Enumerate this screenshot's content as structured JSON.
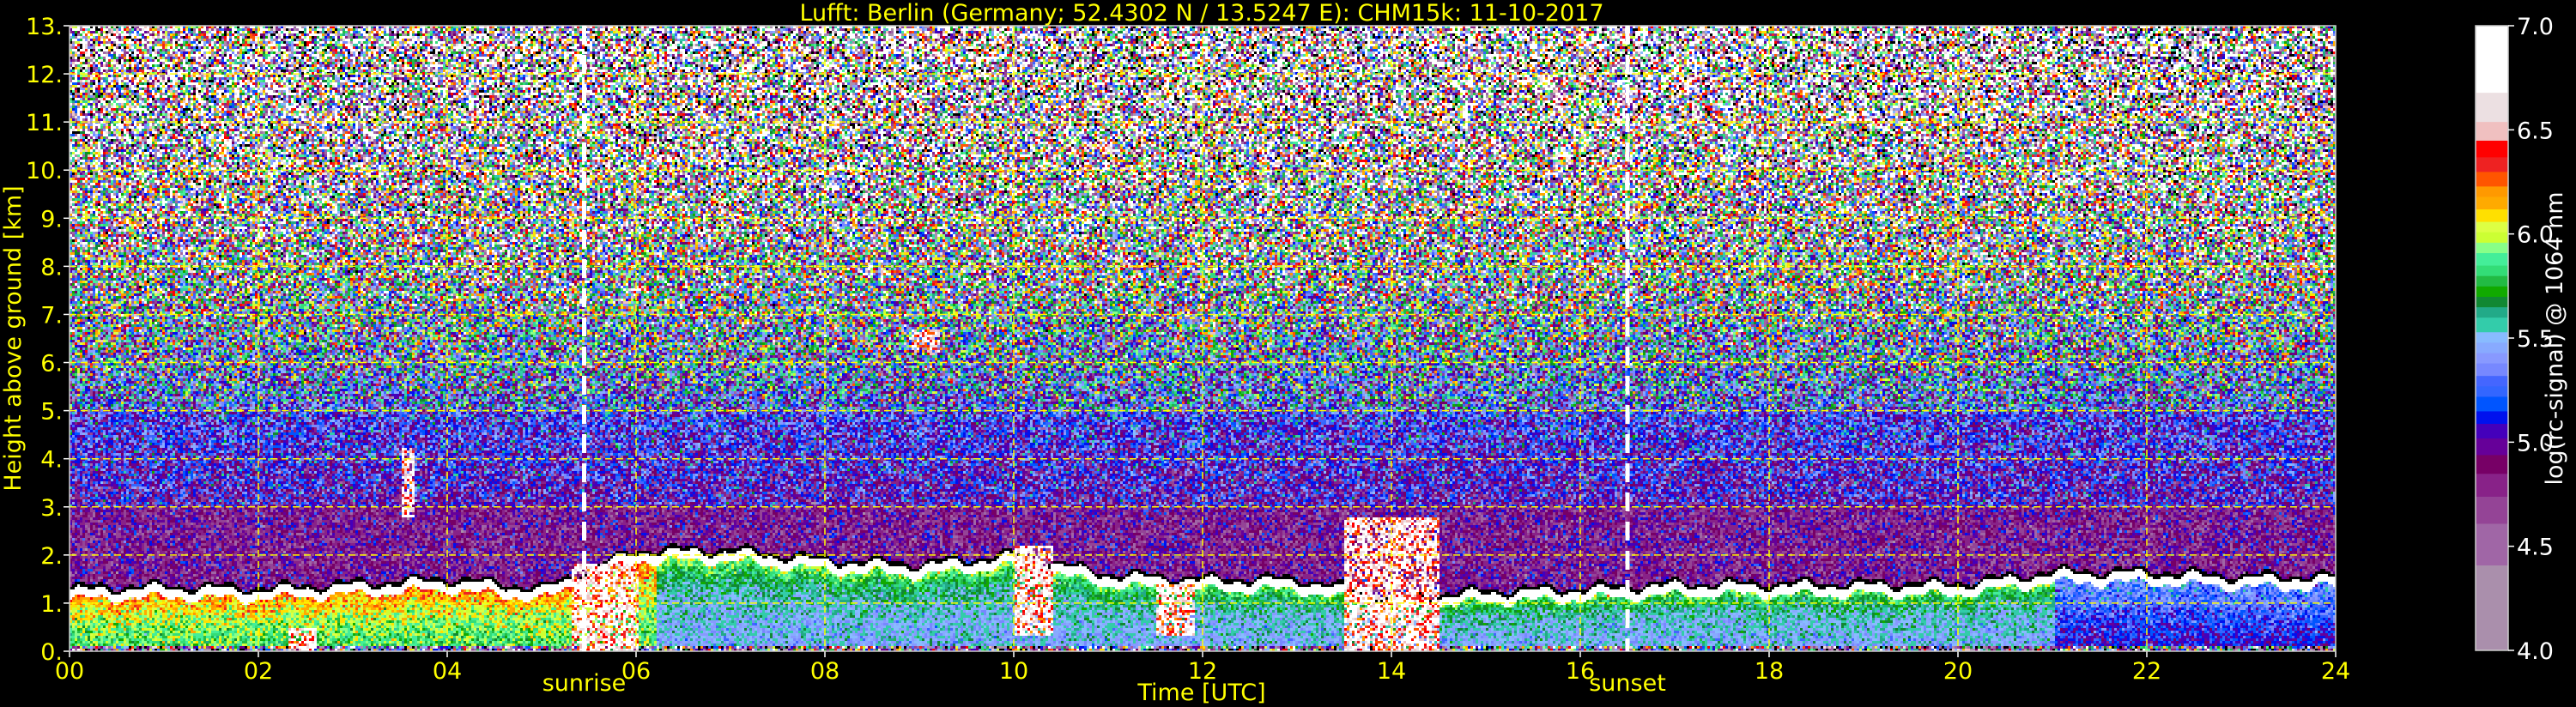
{
  "chart_data": {
    "type": "heatmap",
    "title": "Lufft: Berlin (Germany; 52.4302 N / 13.5247 E):    CHM15k: 11-10-2017",
    "xlabel": "Time [UTC]",
    "ylabel": "Height above ground [km]",
    "xlim": [
      0,
      24
    ],
    "ylim": [
      0,
      13
    ],
    "x_ticks": [
      "00",
      "02",
      "04",
      "06",
      "08",
      "10",
      "12",
      "14",
      "16",
      "18",
      "20",
      "22",
      "24"
    ],
    "x_tick_values": [
      0,
      2,
      4,
      6,
      8,
      10,
      12,
      14,
      16,
      18,
      20,
      22,
      24
    ],
    "y_ticks": [
      "0.",
      "1.",
      "2.",
      "3.",
      "4.",
      "5.",
      "6.",
      "7.",
      "8.",
      "9.",
      "10.",
      "11.",
      "12.",
      "13."
    ],
    "y_tick_values": [
      0,
      1,
      2,
      3,
      4,
      5,
      6,
      7,
      8,
      9,
      10,
      11,
      12,
      13
    ],
    "grid": true,
    "annotations": [
      {
        "label": "sunrise",
        "time_h": 5.45
      },
      {
        "label": "sunset",
        "time_h": 16.5
      }
    ],
    "colorbar": {
      "label": "log(rc-signal) @ 1064 nm",
      "range": [
        4.0,
        7.0
      ],
      "ticks": [
        "4.0",
        "4.5",
        "5.0",
        "5.5",
        "6.0",
        "6.5",
        "7.0"
      ],
      "tick_values": [
        4.0,
        4.5,
        5.0,
        5.5,
        6.0,
        6.5,
        7.0
      ],
      "levels": [
        {
          "from": 4.0,
          "to": 4.41,
          "color": "#aa8fac"
        },
        {
          "from": 4.41,
          "to": 4.61,
          "color": "#a066a6"
        },
        {
          "from": 4.61,
          "to": 4.74,
          "color": "#944496"
        },
        {
          "from": 4.74,
          "to": 4.85,
          "color": "#882288"
        },
        {
          "from": 4.85,
          "to": 4.94,
          "color": "#770066"
        },
        {
          "from": 4.94,
          "to": 5.02,
          "color": "#660099"
        },
        {
          "from": 5.02,
          "to": 5.09,
          "color": "#4400bb"
        },
        {
          "from": 5.09,
          "to": 5.15,
          "color": "#0011ee"
        },
        {
          "from": 5.15,
          "to": 5.22,
          "color": "#0055ff"
        },
        {
          "from": 5.22,
          "to": 5.27,
          "color": "#3366ff"
        },
        {
          "from": 5.27,
          "to": 5.32,
          "color": "#4466ff"
        },
        {
          "from": 5.32,
          "to": 5.38,
          "color": "#7788ff"
        },
        {
          "from": 5.38,
          "to": 5.43,
          "color": "#8899ff"
        },
        {
          "from": 5.43,
          "to": 5.48,
          "color": "#88aaff"
        },
        {
          "from": 5.48,
          "to": 5.53,
          "color": "#88bbff"
        },
        {
          "from": 5.53,
          "to": 5.6,
          "color": "#33ccaa"
        },
        {
          "from": 5.6,
          "to": 5.65,
          "color": "#22aa88"
        },
        {
          "from": 5.65,
          "to": 5.7,
          "color": "#118833"
        },
        {
          "from": 5.7,
          "to": 5.75,
          "color": "#11aa00"
        },
        {
          "from": 5.75,
          "to": 5.8,
          "color": "#22bb44"
        },
        {
          "from": 5.8,
          "to": 5.85,
          "color": "#33dd77"
        },
        {
          "from": 5.85,
          "to": 5.91,
          "color": "#44ee99"
        },
        {
          "from": 5.91,
          "to": 5.96,
          "color": "#88ff88"
        },
        {
          "from": 5.96,
          "to": 6.01,
          "color": "#ccff33"
        },
        {
          "from": 6.01,
          "to": 6.06,
          "color": "#ddff44"
        },
        {
          "from": 6.06,
          "to": 6.12,
          "color": "#ffe000"
        },
        {
          "from": 6.12,
          "to": 6.18,
          "color": "#ffaa00"
        },
        {
          "from": 6.18,
          "to": 6.23,
          "color": "#ff9900"
        },
        {
          "from": 6.23,
          "to": 6.3,
          "color": "#ff5500"
        },
        {
          "from": 6.3,
          "to": 6.37,
          "color": "#ee2222"
        },
        {
          "from": 6.37,
          "to": 6.45,
          "color": "#ff0000"
        },
        {
          "from": 6.45,
          "to": 6.54,
          "color": "#f0c0c0"
        },
        {
          "from": 6.54,
          "to": 6.68,
          "color": "#ece0e2"
        },
        {
          "from": 6.68,
          "to": 7.0,
          "color": "#ffffff"
        }
      ]
    },
    "aerosol_layer_top_km": {
      "time_h": [
        0,
        1,
        2,
        3,
        4,
        5,
        6,
        7,
        8,
        9,
        10,
        11,
        12,
        13,
        14,
        15,
        16,
        17,
        18,
        19,
        20,
        21,
        22,
        23,
        24
      ],
      "height_km": [
        1.2,
        1.25,
        1.2,
        1.3,
        1.4,
        1.2,
        2.0,
        2.0,
        1.8,
        1.7,
        1.9,
        1.5,
        1.4,
        1.4,
        1.0,
        1.15,
        1.2,
        1.3,
        1.3,
        1.3,
        1.3,
        1.55,
        1.55,
        1.45,
        1.45
      ]
    },
    "strong_features": [
      {
        "time_h": [
          2.3,
          2.6
        ],
        "height_km": [
          0.0,
          0.5
        ]
      },
      {
        "time_h": [
          5.3,
          6.0
        ],
        "height_km": [
          0.0,
          1.8
        ]
      },
      {
        "time_h": [
          10.0,
          10.4
        ],
        "height_km": [
          0.3,
          2.2
        ]
      },
      {
        "time_h": [
          11.5,
          11.9
        ],
        "height_km": [
          0.3,
          1.4
        ]
      },
      {
        "time_h": [
          13.5,
          14.5
        ],
        "height_km": [
          0.0,
          2.8
        ]
      },
      {
        "time_h": [
          3.5,
          3.65
        ],
        "height_km": [
          2.8,
          4.2
        ]
      },
      {
        "time_h": [
          8.9,
          9.2
        ],
        "height_km": [
          6.2,
          6.7
        ]
      }
    ],
    "colors": {
      "axis_text": "#ffff00",
      "grid": "#ffff00",
      "colorbar_text": "#ffffff",
      "background": "#000000"
    }
  }
}
